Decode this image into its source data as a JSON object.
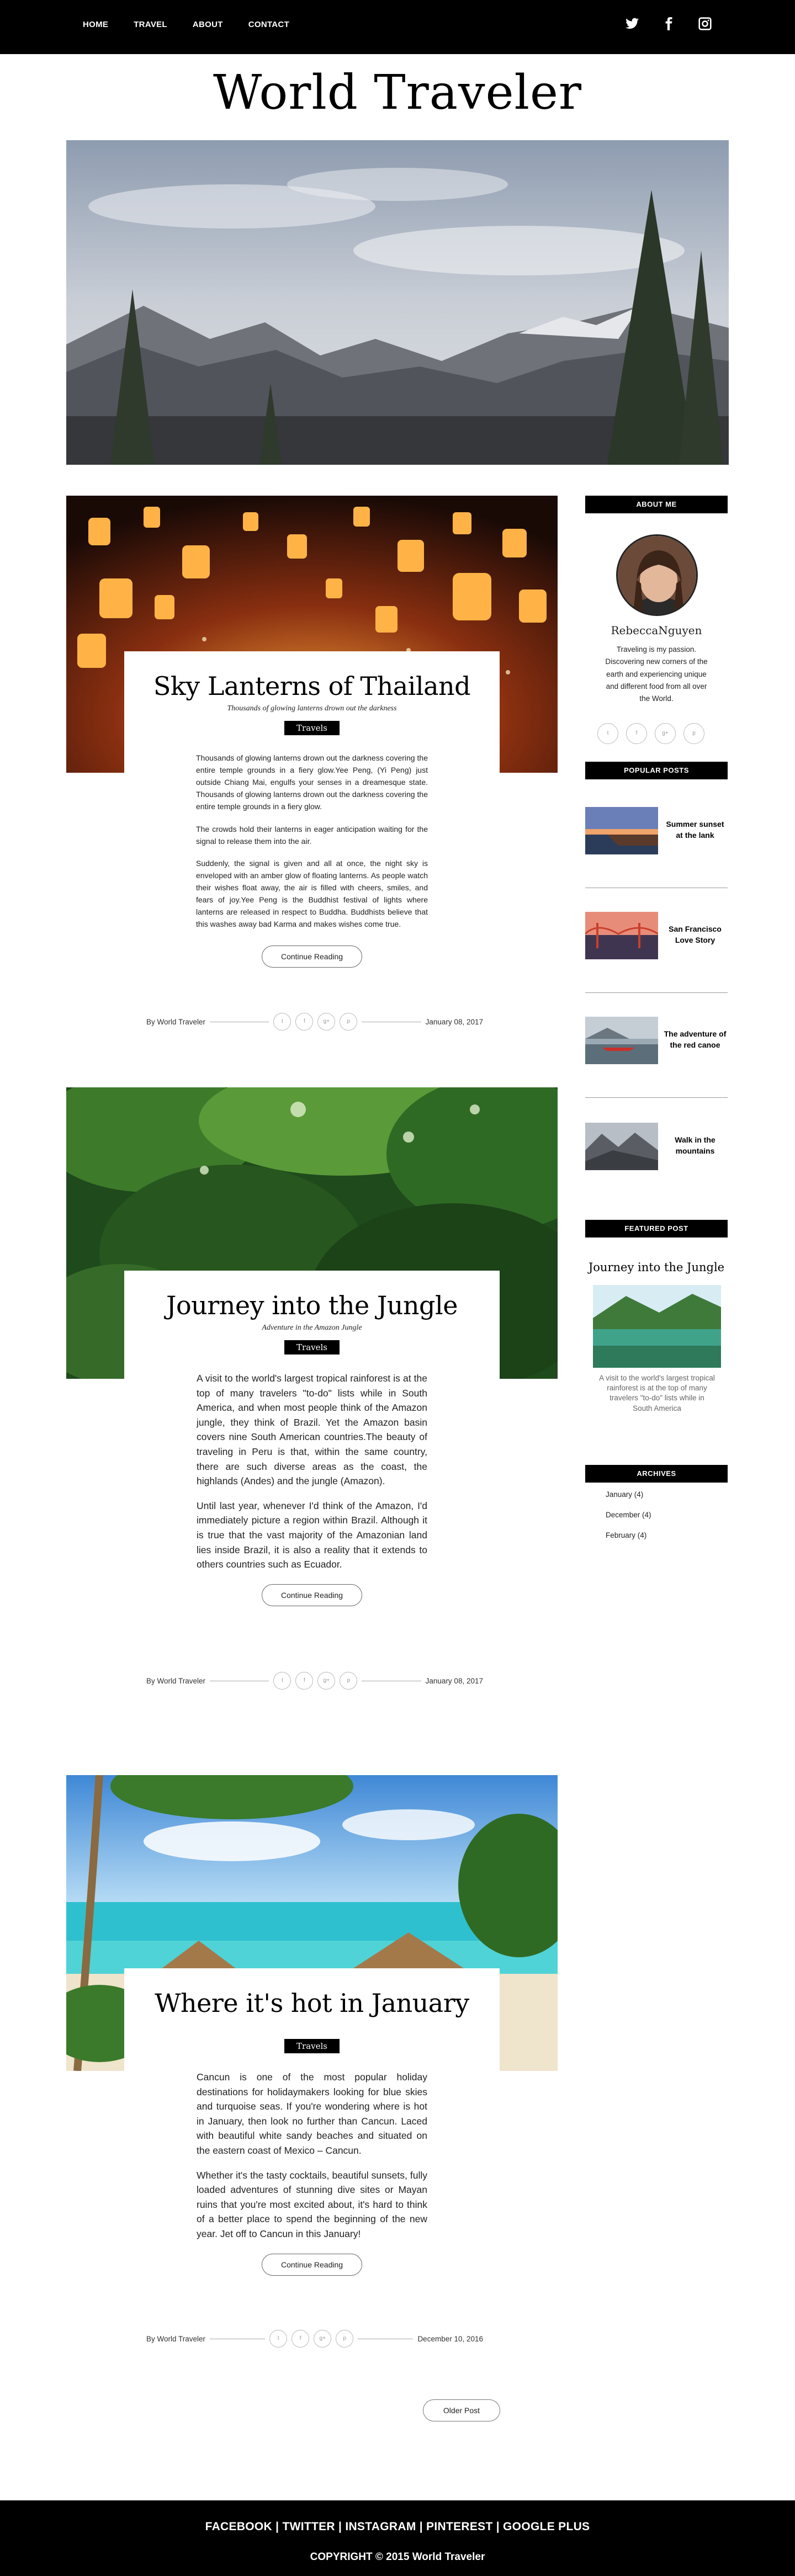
{
  "nav": {
    "links": [
      "HOME",
      "TRAVEL",
      "ABOUT",
      "CONTACT"
    ],
    "social_icons": [
      "twitter-icon",
      "facebook-icon",
      "instagram-icon"
    ]
  },
  "site": {
    "title": "World Traveler"
  },
  "posts": [
    {
      "title": "Sky Lanterns of Thailand",
      "subtitle": "Thousands of glowing lanterns drown out the darkness",
      "tag": "Travels",
      "paragraphs": [
        "Thousands of glowing lanterns drown out the darkness covering the entire temple grounds in a fiery glow.Yee Peng, (Yi Peng) just outside Chiang Mai, engulfs your senses in a dreamesque state. Thousands of glowing lanterns drown out the darkness covering the entire temple grounds in a fiery glow.",
        "The crowds hold their lanterns in eager anticipation waiting for the signal to release them into the air.",
        "Suddenly, the signal is given and all at once, the night sky is enveloped with an amber glow of floating lanterns. As people watch their wishes float away, the air is filled with cheers, smiles, and fears of joy.Yee Peng is the Buddhist festival of lights where lanterns are released in respect to Buddha. Buddhists believe that this washes away bad Karma and makes wishes come true."
      ],
      "button": "Continue Reading",
      "author": "By World Traveler",
      "date": "January 08, 2017"
    },
    {
      "title": "Journey into the Jungle",
      "subtitle": "Adventure in the Amazon Jungle",
      "tag": "Travels",
      "paragraphs": [
        "A visit to the world's largest tropical rainforest is at the top of many travelers \"to-do\" lists while in South America, and when most people think of the Amazon jungle, they think of Brazil. Yet the Amazon basin covers nine South American countries.The beauty of traveling in Peru is that, within the same country, there are such diverse areas as the coast, the highlands (Andes) and the jungle (Amazon).",
        "Until last year, whenever I'd think of the Amazon, I'd immediately picture a region within Brazil. Although it is true that the vast majority of the Amazonian land lies inside Brazil, it is also a reality that it extends to others countries such as Ecuador."
      ],
      "button": "Continue Reading",
      "author": "By World Traveler",
      "date": "January 08, 2017"
    },
    {
      "title": "Where it's hot in January",
      "subtitle": "",
      "tag": "Travels",
      "paragraphs": [
        "Cancun is one of the most popular holiday destinations for holidaymakers looking for blue skies and turquoise seas. If you're wondering where is hot in January, then look no further than Cancun. Laced with beautiful white sandy beaches and situated on the eastern coast of Mexico – Cancun.",
        "Whether it's the tasty cocktails, beautiful sunsets, fully loaded adventures of stunning dive sites or Mayan ruins that you're most excited about, it's hard to think of a better place to spend the beginning of the new year. Jet off to Cancun in this January!"
      ],
      "button": "Continue Reading",
      "author": "By World Traveler",
      "date": "December 10, 2016"
    }
  ],
  "share_icons": [
    "twitter-icon",
    "facebook-icon",
    "google-plus-icon",
    "pinterest-icon"
  ],
  "sidebar": {
    "about": {
      "heading": "ABOUT ME",
      "name": "RebeccaNguyen",
      "text": "Traveling is my passion. Discovering new corners of the earth and experiencing unique and different food from all over the World."
    },
    "popular": {
      "heading": "POPULAR POSTS",
      "items": [
        "Summer sunset at the lank",
        "San Francisco Love Story",
        "The adventure of the red canoe",
        "Walk in the mountains"
      ]
    },
    "featured": {
      "heading": "FEATURED POST",
      "title": "Journey into the Jungle",
      "text": "A visit to the world's largest tropical rainforest is at the top of many travelers \"to-do\" lists while in South America"
    },
    "archives": {
      "heading": "ARCHIVES",
      "items": [
        "January (4)",
        "December (4)",
        "February (4)"
      ]
    }
  },
  "pagination": {
    "older": "Older Post"
  },
  "footer": {
    "links": "FACEBOOK | TWITTER | INSTAGRAM | PINTEREST | GOOGLE PLUS",
    "copyright": "COPYRIGHT © 2015 World Traveler"
  },
  "colors": {
    "accent": "#000000",
    "background": "#ffffff",
    "text": "#222222"
  }
}
